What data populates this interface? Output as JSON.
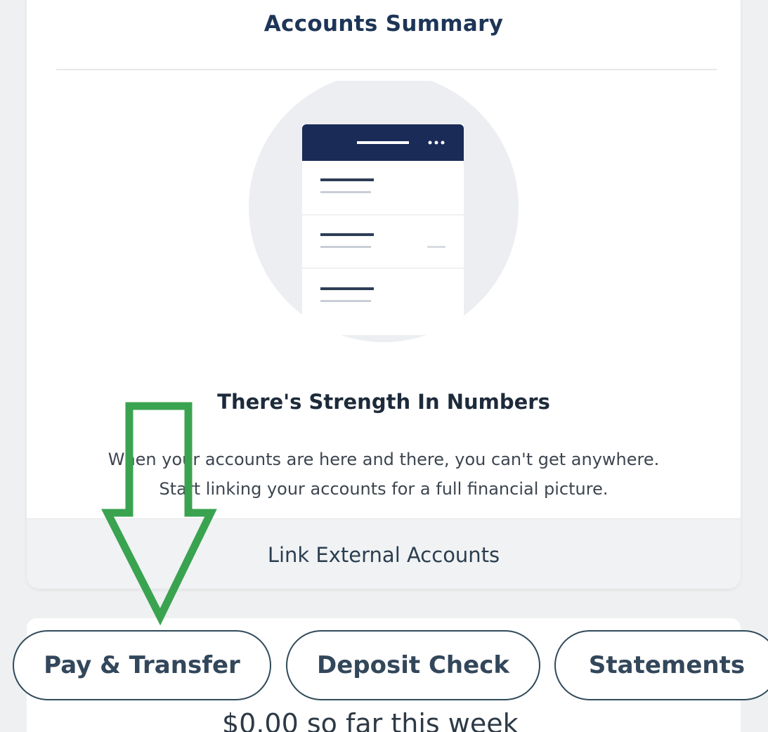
{
  "summary": {
    "title": "Accounts Summary",
    "headline": "There's Strength In Numbers",
    "body_line_1": "When your accounts are here and there, you can't get anywhere.",
    "body_line_2": "Start linking your accounts for a full financial picture.",
    "link_label": "Link External Accounts"
  },
  "actions": {
    "pay_transfer": "Pay & Transfer",
    "deposit_check": "Deposit Check",
    "statements": "Statements"
  },
  "spending": {
    "week_text": "$0.00 so far this week"
  },
  "annotation": {
    "arrow_color": "#3aa350",
    "direction": "down"
  },
  "colors": {
    "brand_navy": "#1b2b57",
    "text_dark": "#1d2a3a",
    "pill_border": "#2f4a5a"
  }
}
